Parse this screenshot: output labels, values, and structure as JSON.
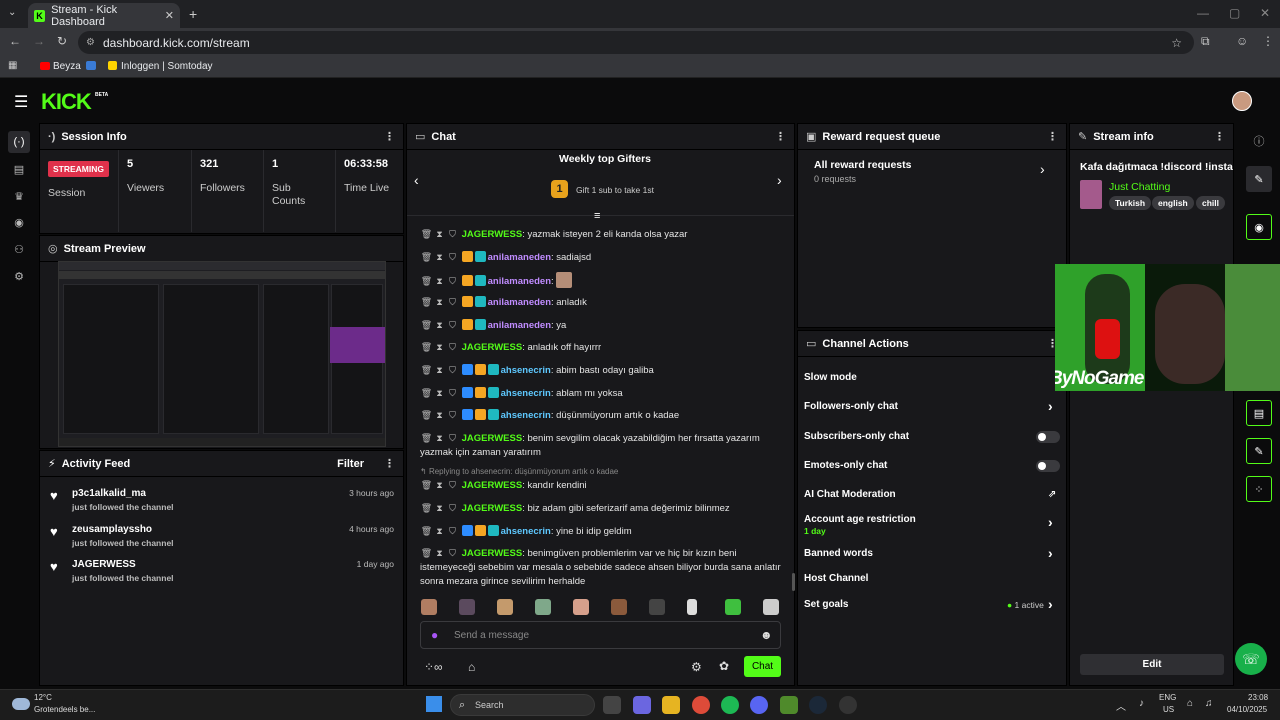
{
  "browser": {
    "tab_title": "Stream - Kick Dashboard",
    "url": "dashboard.kick.com/stream",
    "bookmarks": [
      "Beyza",
      "Inloggen | Somtoday"
    ]
  },
  "app": {
    "logo": "KICK",
    "beta": "BETA"
  },
  "session": {
    "title": "Session Info",
    "status_badge": "STREAMING",
    "status_label": "Session",
    "stats": [
      {
        "value": "5",
        "label": "Viewers"
      },
      {
        "value": "321",
        "label": "Followers"
      },
      {
        "value": "1",
        "label": "Sub Counts"
      },
      {
        "value": "06:33:58",
        "label": "Time Live"
      }
    ]
  },
  "preview": {
    "title": "Stream Preview"
  },
  "activity": {
    "title": "Activity Feed",
    "filter": "Filter",
    "items": [
      {
        "name": "p3c1alkalid_ma",
        "sub": "just followed the channel",
        "time": "3 hours ago"
      },
      {
        "name": "zeusamplayssho",
        "sub": "just followed the channel",
        "time": "4 hours ago"
      },
      {
        "name": "JAGERWESS",
        "sub": "just followed the channel",
        "time": "1 day ago"
      }
    ]
  },
  "chat": {
    "title": "Chat",
    "gifters_title": "Weekly top Gifters",
    "gifters_rank": "1",
    "gifters_text": "Gift 1 sub to take 1st",
    "messages": [
      {
        "user": "JAGERWESS",
        "text": ": yazmak isteyen 2 eli kanda olsa yazar"
      },
      {
        "user": "anilamaneden",
        "text": ": sadiajsd"
      },
      {
        "user": "anilamaneden",
        "text": ":"
      },
      {
        "user": "anilamaneden",
        "text": ": anladık"
      },
      {
        "user": "anilamaneden",
        "text": ": ya"
      },
      {
        "user": "JAGERWESS",
        "text": ": anladık off hayırrr"
      },
      {
        "user": "ahsenecrin",
        "text": ": abim bastı odayı galiba"
      },
      {
        "user": "ahsenecrin",
        "text": ": ablam mı yoksa"
      },
      {
        "user": "ahsenecrin",
        "text": ": düşünmüyorum artık o kadae"
      },
      {
        "user": "JAGERWESS",
        "text": ": benim sevgilim olacak yazabildiğim her fırsatta yazarım yazmak için zaman yaratırım"
      },
      {
        "user": "JAGERWESS",
        "text": ": kandır kendini"
      },
      {
        "user": "JAGERWESS",
        "text": ": biz adam gibi seferizarif ama değerimiz bilinmez"
      },
      {
        "user": "ahsenecrin",
        "text": ": yine bi idip geldim"
      },
      {
        "user": "JAGERWESS",
        "text": ": benimgüven problemlerim var ve hiç bir kızın beni istemeyeceği sebebim var mesala o sebebide sadece ahsen biliyor burda sana anlatır sonra mezara girince sevilirim herhalde"
      }
    ],
    "reply_to": "Replying to ahsenecrin: düşünmüyorum artık o kadae",
    "input_placeholder": "Send a message",
    "send_label": "Chat"
  },
  "reward": {
    "title": "Reward request queue",
    "all_label": "All reward requests",
    "count": "0 requests"
  },
  "actions": {
    "title": "Channel Actions",
    "slow": "Slow mode",
    "followers_only": "Followers-only chat",
    "subscribers_only": "Subscribers-only chat",
    "emotes_only": "Emotes-only chat",
    "ai_mod": "AI Chat Moderation",
    "account_age": "Account age restriction",
    "account_age_value": "1 day",
    "banned": "Banned words",
    "host": "Host Channel",
    "goals": "Set goals",
    "goals_status": "1 active"
  },
  "stream_info": {
    "title": "Stream info",
    "stream_title": "Kafa dağıtmaca !discord !insta",
    "category": "Just Chatting",
    "tags": [
      "Turkish",
      "english",
      "chill"
    ],
    "edit": "Edit"
  },
  "overlay": {
    "watermark": "ByNoGame"
  },
  "taskbar": {
    "temp": "12°C",
    "weather": "Grotendeels be...",
    "search": "Search",
    "lang1": "ENG",
    "lang2": "US",
    "time": "23:08",
    "date": "04/10/2025"
  },
  "colors": {
    "accent": "#53fc18",
    "panel": "#18181b",
    "background": "#0b0b0c"
  }
}
